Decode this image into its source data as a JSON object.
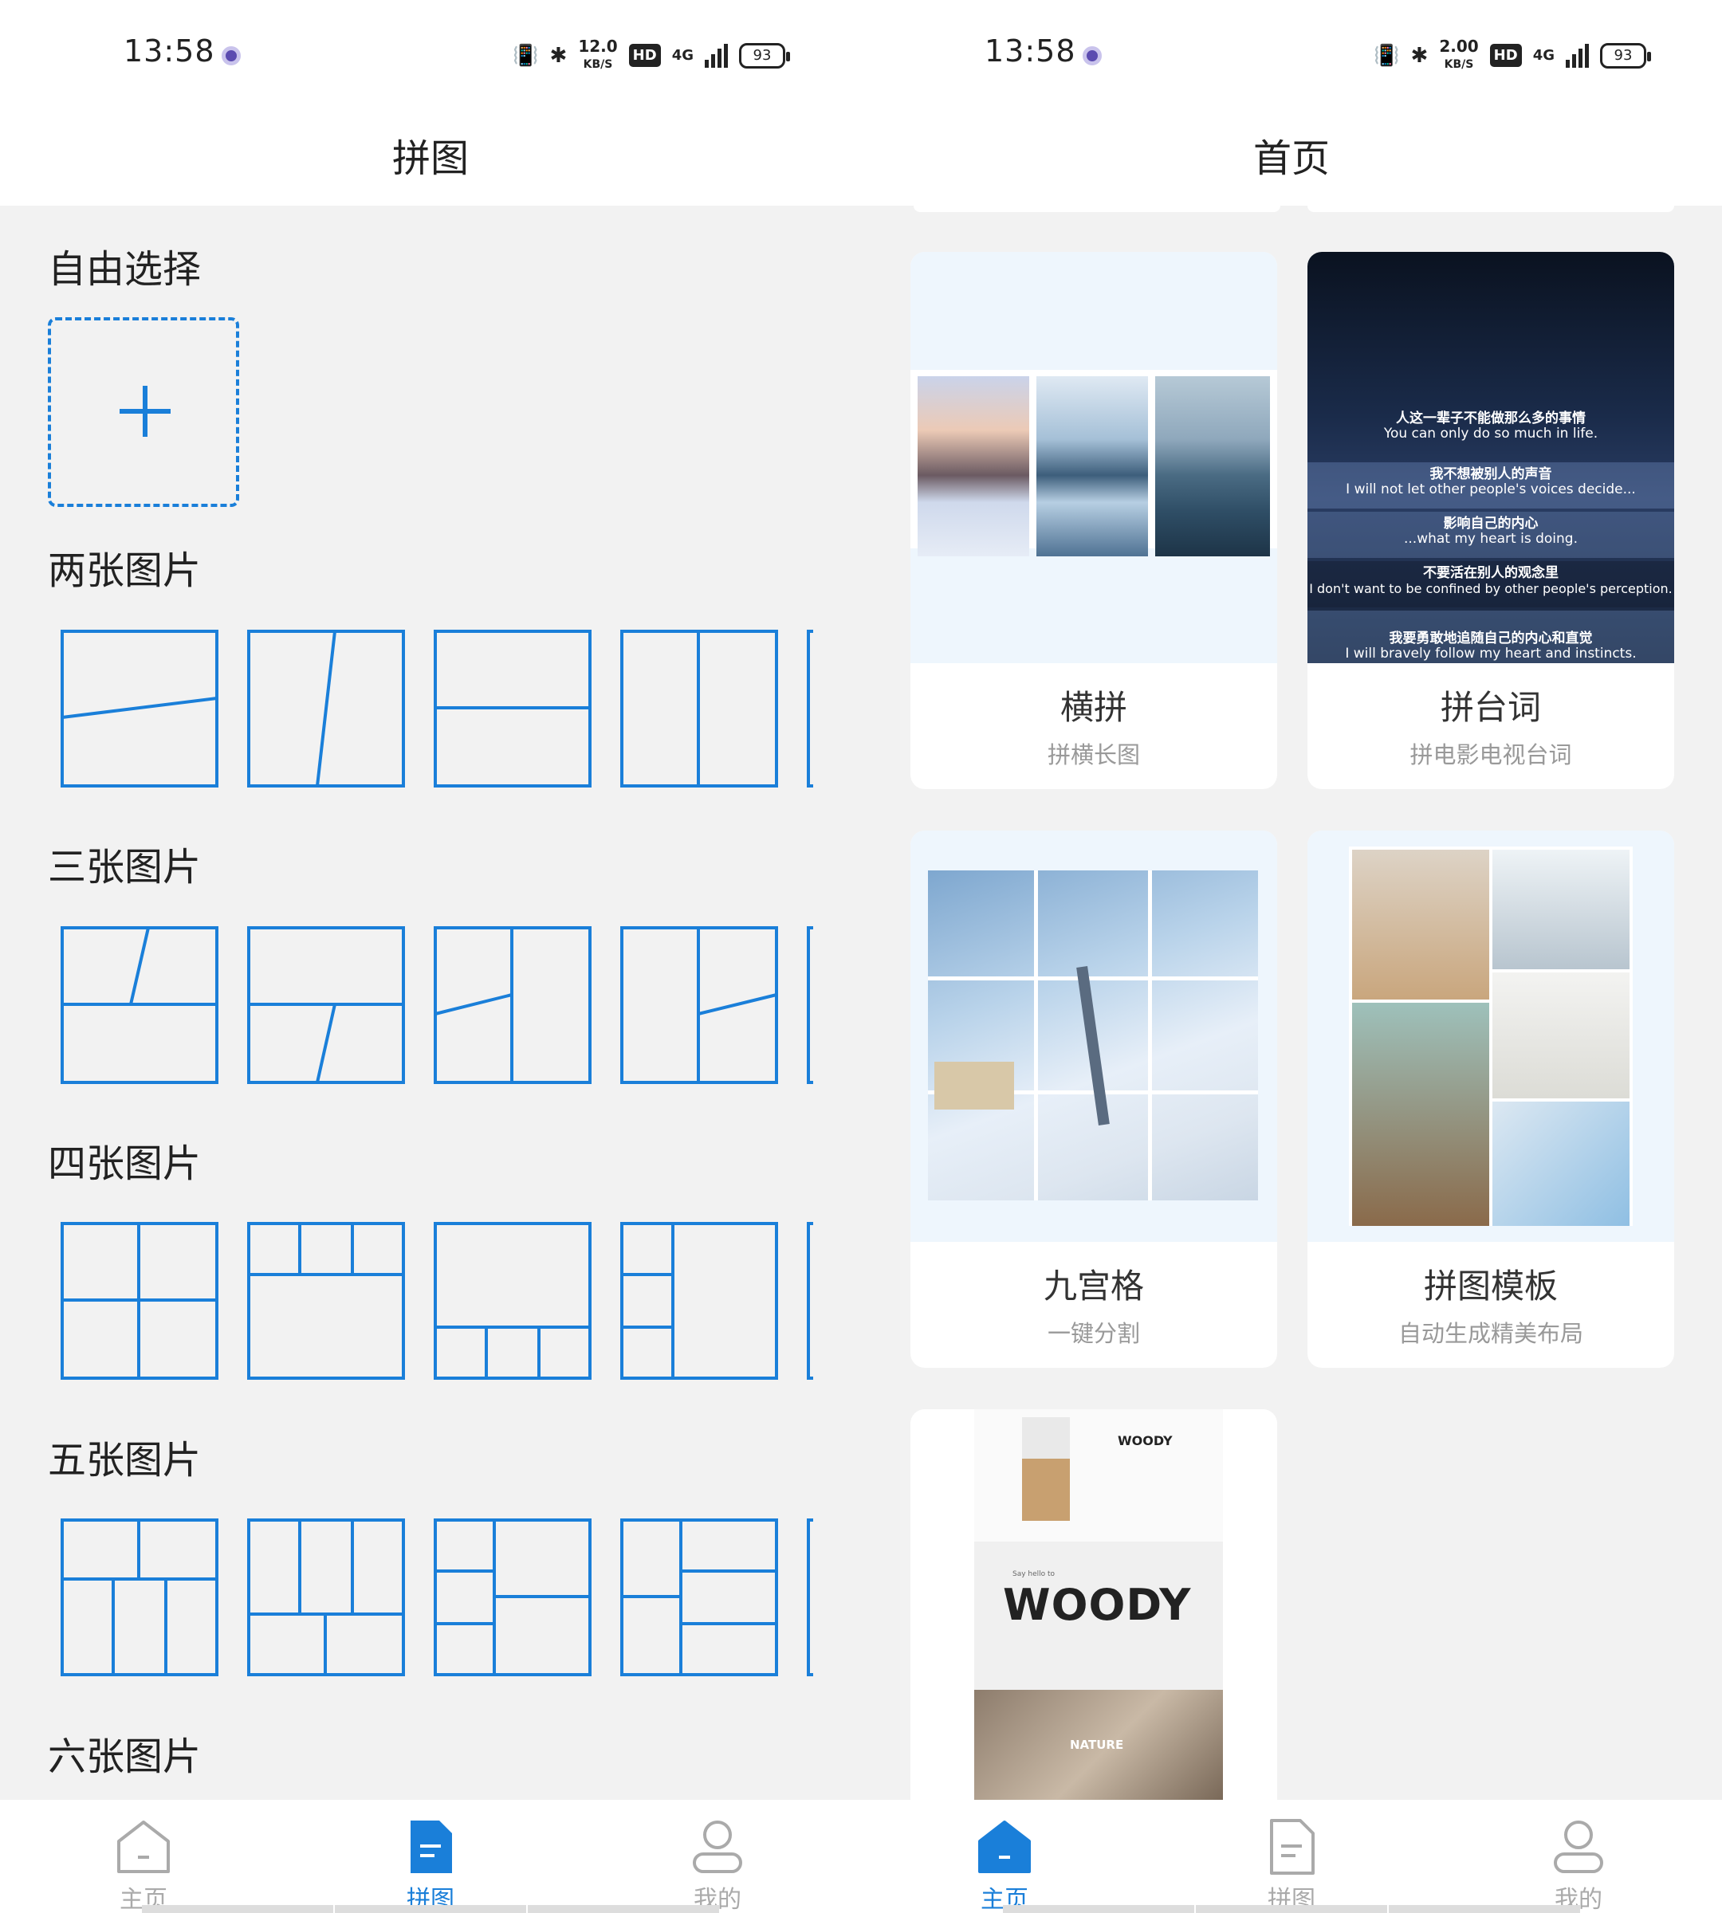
{
  "left_screen": {
    "status": {
      "time": "13:58",
      "speed_value": "12.0",
      "speed_unit": "KB/S",
      "hd": "HD",
      "network": "4G",
      "battery": "93"
    },
    "title": "拼图",
    "sections": {
      "free": "自由选择",
      "two": "两张图片",
      "three": "三张图片",
      "four": "四张图片",
      "five": "五张图片",
      "six": "六张图片"
    },
    "nav": {
      "home": "主页",
      "collage": "拼图",
      "mine": "我的"
    }
  },
  "right_screen": {
    "status": {
      "time": "13:58",
      "speed_value": "2.00",
      "speed_unit": "KB/S",
      "hd": "HD",
      "network": "4G",
      "battery": "93"
    },
    "title": "首页",
    "cards": [
      {
        "title": "横拼",
        "subtitle": "拼横长图"
      },
      {
        "title": "拼台词",
        "subtitle": "拼电影电视台词"
      },
      {
        "title": "九宫格",
        "subtitle": "一键分割"
      },
      {
        "title": "拼图模板",
        "subtitle": "自动生成精美布局"
      }
    ],
    "subtitle_card": {
      "lines_cn": [
        "人这一辈子不能做那么多的事情",
        "我不想被别人的声音",
        "影响自己的内心",
        "不要活在别人的观念里",
        "我要勇敢地追随自己的内心和直觉"
      ],
      "lines_en": [
        "You can only do so much in life.",
        "I will not let other people's voices decide...",
        "...what my heart is doing.",
        "I don't want to be confined by other people's perception.",
        "I will bravely follow my heart and instincts."
      ]
    },
    "template_card": {
      "brand": "WOODY",
      "big": "WOODY",
      "tagline": "Say hello to",
      "nature": "NATURE"
    },
    "nav": {
      "home": "主页",
      "collage": "拼图",
      "mine": "我的"
    }
  },
  "colors": {
    "accent": "#1a7fd9",
    "background": "#f2f2f2",
    "inactive": "#aaaaaa"
  }
}
